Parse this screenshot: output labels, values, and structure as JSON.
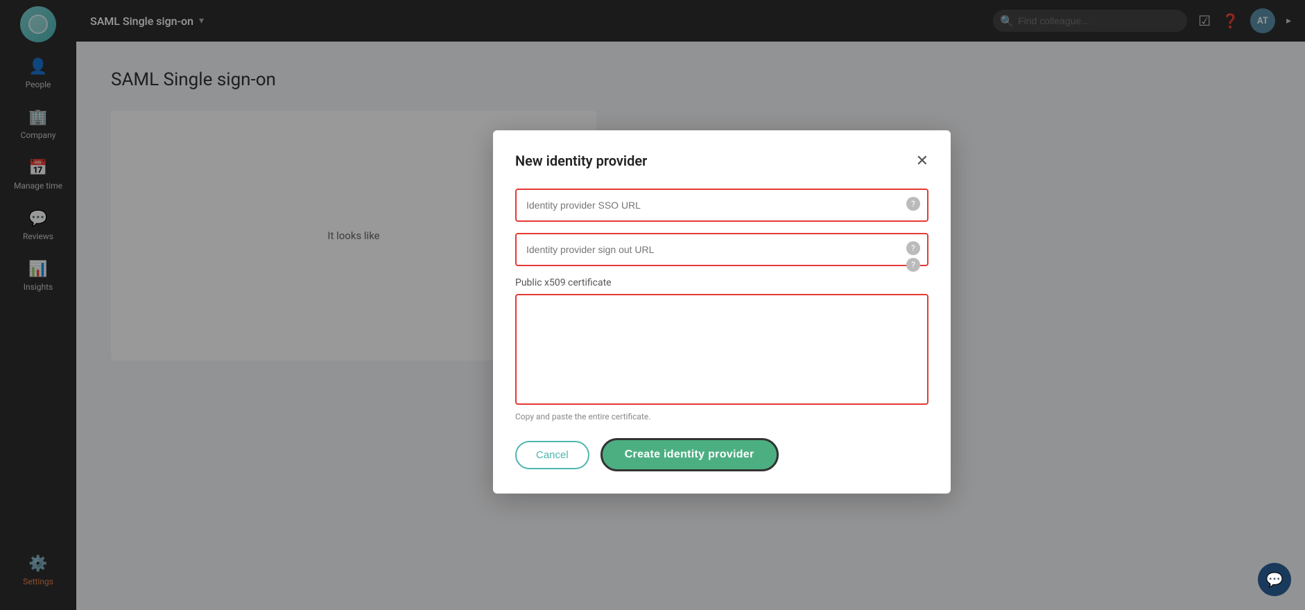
{
  "sidebar": {
    "items": [
      {
        "id": "people",
        "label": "People",
        "icon": "👤"
      },
      {
        "id": "company",
        "label": "Company",
        "icon": "🏢"
      },
      {
        "id": "manage-time",
        "label": "Manage time",
        "icon": "📅"
      },
      {
        "id": "reviews",
        "label": "Reviews",
        "icon": "💬"
      },
      {
        "id": "insights",
        "label": "Insights",
        "icon": "📊"
      }
    ],
    "settings": {
      "label": "Settings",
      "icon": "⚙️"
    }
  },
  "topbar": {
    "title": "SAML Single sign-on",
    "search_placeholder": "Find colleague...",
    "avatar_initials": "AT"
  },
  "page": {
    "title": "SAML Single sign-on",
    "content_text": "It looks like"
  },
  "modal": {
    "title": "New identity provider",
    "sso_url_placeholder": "Identity provider SSO URL",
    "sign_out_url_placeholder": "Identity provider sign out URL",
    "cert_label": "Public x509 certificate",
    "cert_hint": "Copy and paste the entire certificate.",
    "cancel_label": "Cancel",
    "create_label": "Create identity provider"
  }
}
